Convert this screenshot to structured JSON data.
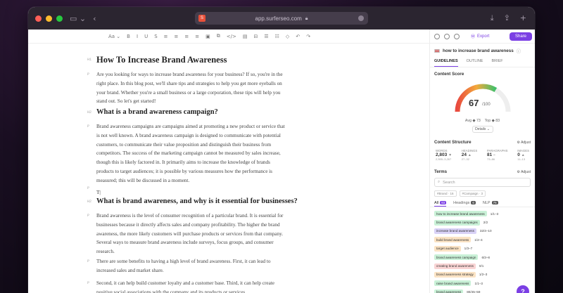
{
  "browser": {
    "url": "app.surferseo.com",
    "colors": {
      "close": "#ff5f57",
      "minimize": "#febc2e",
      "maximize": "#28c840"
    }
  },
  "toolbar": {
    "items": [
      "Aa ⌄",
      "B",
      "I",
      "U",
      "S",
      "≡",
      "≡",
      "≡",
      "≡",
      "▣",
      "⧉",
      "</>",
      "▤",
      "⊟",
      "☰",
      "☷",
      "◇",
      "↶",
      "↷"
    ]
  },
  "doc": {
    "h1_tag": "H1",
    "h1": "How To Increase Brand Awareness",
    "p1": "Are you looking for ways to increase brand awareness for your business? If so, you're in the\nright place. In this blog post, we'll share tips and strategies to help you get more eyeballs on\nyour brand. Whether you're a small business or a large corporation, these tips will help you\nstand out. So let's get started!",
    "h2a": "What is a brand awareness campaign?",
    "p2": "Brand awareness campaigns are campaigns aimed at promoting a new product or service that\nis not well known. A brand awareness campaign is designed to communicate with potential\ncustomers, to communicate their value proposition and distinguish their business from\ncompetitors. The success of the marketing campaign cannot be measured by sales increase,\nthough this is likely factored in. It primarily aims to increase the knowledge of brands\nproducts to target audiences; it is possible by various measures how the performance is\nmeasured; this will be discussed in a moment.",
    "cursor_text": "T|",
    "h2b": "What is brand awareness, and why is it essential for businesses?",
    "p3": "Brand awareness is the level of consumer recognition of a particular brand. It is essential for\nbusinesses because it directly affects sales and company profitability. The higher the brand\nawareness, the more likely customers will purchase products or services from that company.\nSeveral ways to measure brand awareness include surveys, focus groups, and consumer\nresearch.",
    "p4": "There are some benefits to having a high level of brand awareness. First, it can lead to\nincreased sales and market share.",
    "p5": "Second, it can help build customer loyalty and a customer base. Third, it can help create\npositive social associations with the company and its products or services."
  },
  "panel": {
    "export": "Export",
    "share": "Share",
    "keyword": "how to increase brand awareness",
    "tabs": [
      "GUIDELINES",
      "OUTLINE",
      "BRIEF"
    ],
    "content_score_title": "Content Score",
    "score": 67,
    "score_max": 100,
    "score_fraction": 0.67,
    "avg": "Avg ◆ 73",
    "top": "Top ◆ 83",
    "details": "Details ⌄",
    "structure_title": "Content Structure",
    "adjust": "Adjust",
    "stats": [
      {
        "label": "WORDS",
        "value": "2,803",
        "arrow": "▼",
        "range": "2,555–3,267"
      },
      {
        "label": "HEADINGS",
        "value": "24",
        "arrow": "▲",
        "range": "27–32"
      },
      {
        "label": "PARAGRAPHS",
        "value": "81",
        "arrow": "–",
        "range": "73–86"
      },
      {
        "label": "IMAGES",
        "value": "0",
        "arrow": "▲",
        "range": "11–13"
      }
    ],
    "terms_title": "Terms",
    "search_placeholder": "Search",
    "filters": [
      "#Brand · 16",
      "#Campaign · 3"
    ],
    "term_tabs": {
      "all": "All",
      "all_count": "93",
      "headings": "Headings",
      "headings_count": "6",
      "nlp": "NLP",
      "nlp_count": "76"
    },
    "terms": [
      {
        "name": "how to increase brand awareness",
        "count": "1/1–3",
        "color": "#c9f1d7"
      },
      {
        "name": "brand awareness campaigns",
        "count": "2/2",
        "color": "#c9f1d7"
      },
      {
        "name": "increase brand awareness",
        "count": "32/4–10",
        "color": "#d9d2f7"
      },
      {
        "name": "build brand awareness",
        "count": "1/2–4",
        "color": "#fbe3c4"
      },
      {
        "name": "target audience",
        "count": "1/3–7",
        "color": "#fbe3c4"
      },
      {
        "name": "brand awareness campaign",
        "count": "6/3–8",
        "color": "#c9f1d7"
      },
      {
        "name": "creating brand awareness",
        "count": "0/1",
        "color": "#f9d4d4"
      },
      {
        "name": "brand awareness strategy",
        "count": "1/2–3",
        "color": "#fbe3c4"
      },
      {
        "name": "raise brand awareness",
        "count": "1/1–3",
        "color": "#c9f1d7"
      },
      {
        "name": "brand awareness",
        "count": "80/45–59",
        "color": "#c9f1d7"
      }
    ]
  }
}
